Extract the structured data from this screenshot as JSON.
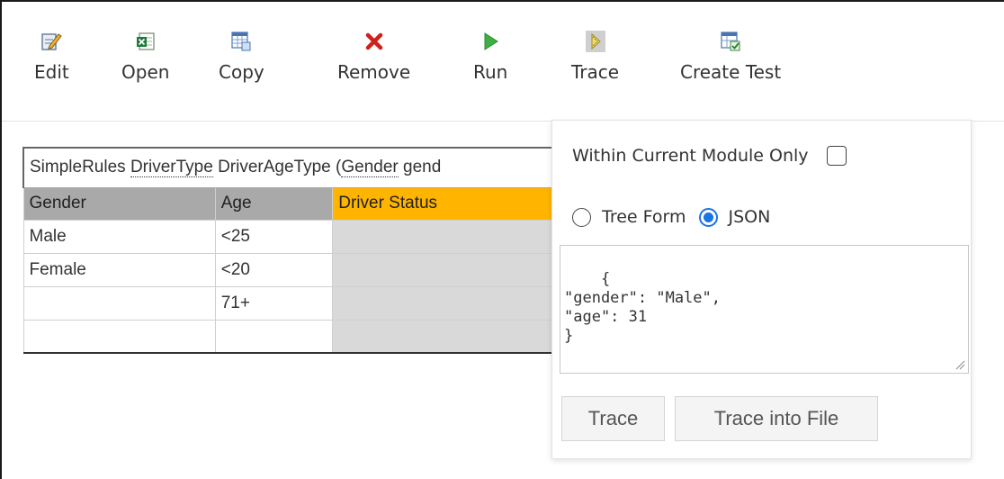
{
  "toolbar": {
    "items": [
      {
        "label": "Edit",
        "icon": "edit-icon"
      },
      {
        "label": "Open",
        "icon": "excel-icon"
      },
      {
        "label": "Copy",
        "icon": "copy-table-icon"
      },
      {
        "label": "Remove",
        "icon": "remove-icon"
      },
      {
        "label": "Run",
        "icon": "run-icon"
      },
      {
        "label": "Trace",
        "icon": "trace-icon"
      },
      {
        "label": "Create Test",
        "icon": "create-test-icon"
      }
    ]
  },
  "table": {
    "title_parts": [
      "SimpleRules ",
      "DriverType",
      " DriverAgeType (",
      "Gender",
      " gend"
    ],
    "headers": [
      "Gender",
      "Age",
      "Driver Status"
    ],
    "rows": [
      [
        "Male",
        "<25",
        ""
      ],
      [
        "Female",
        "<20",
        ""
      ],
      [
        "",
        "71+",
        ""
      ],
      [
        "",
        "",
        ""
      ]
    ]
  },
  "trace_popup": {
    "module_only_label": "Within Current Module Only",
    "module_only_checked": false,
    "options": [
      "Tree Form",
      "JSON"
    ],
    "selected_option": "JSON",
    "json_input": "{\n\"gender\": \"Male\",\n\"age\": 31\n}",
    "trace_button": "Trace",
    "trace_file_button": "Trace into File"
  },
  "colors": {
    "header_grey": "#a9a9a9",
    "status_header": "#ffb400",
    "radio_accent": "#1a73e8",
    "remove_red": "#d0201a",
    "run_green": "#3cb043"
  }
}
